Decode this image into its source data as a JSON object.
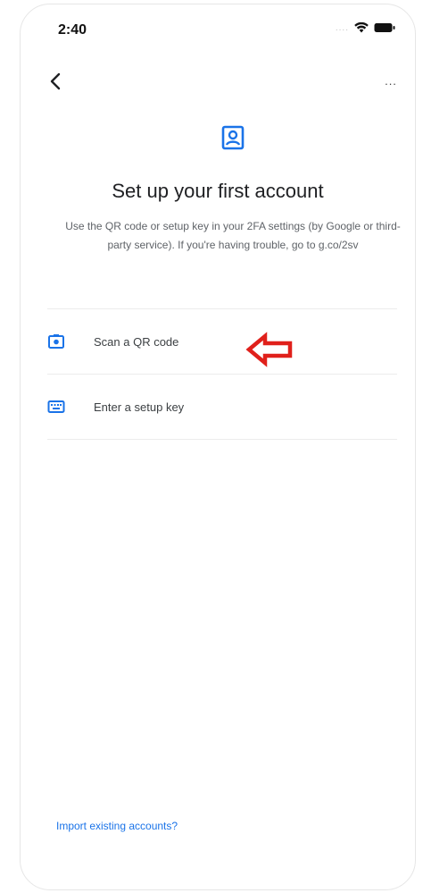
{
  "status_bar": {
    "time": "2:40",
    "signal_text": "....",
    "wifi_icon": "wifi-icon",
    "battery_icon": "battery-icon"
  },
  "nav": {
    "back_icon": "chevron-left-icon",
    "more_label": "..."
  },
  "header": {
    "icon": "account-badge-icon",
    "accent_color": "#1a73e8",
    "title": "Set up your first account",
    "description": "Use the QR code or setup key in your 2FA settings (by Google or third-party service). If you're having trouble, go to g.co/2sv"
  },
  "options": [
    {
      "label": "Scan a QR code",
      "icon": "camera-icon"
    },
    {
      "label": "Enter a setup key",
      "icon": "keyboard-icon"
    }
  ],
  "annotation": {
    "icon": "red-arrow-icon",
    "color": "#e0201b"
  },
  "footer": {
    "import_link": "Import existing accounts?"
  }
}
